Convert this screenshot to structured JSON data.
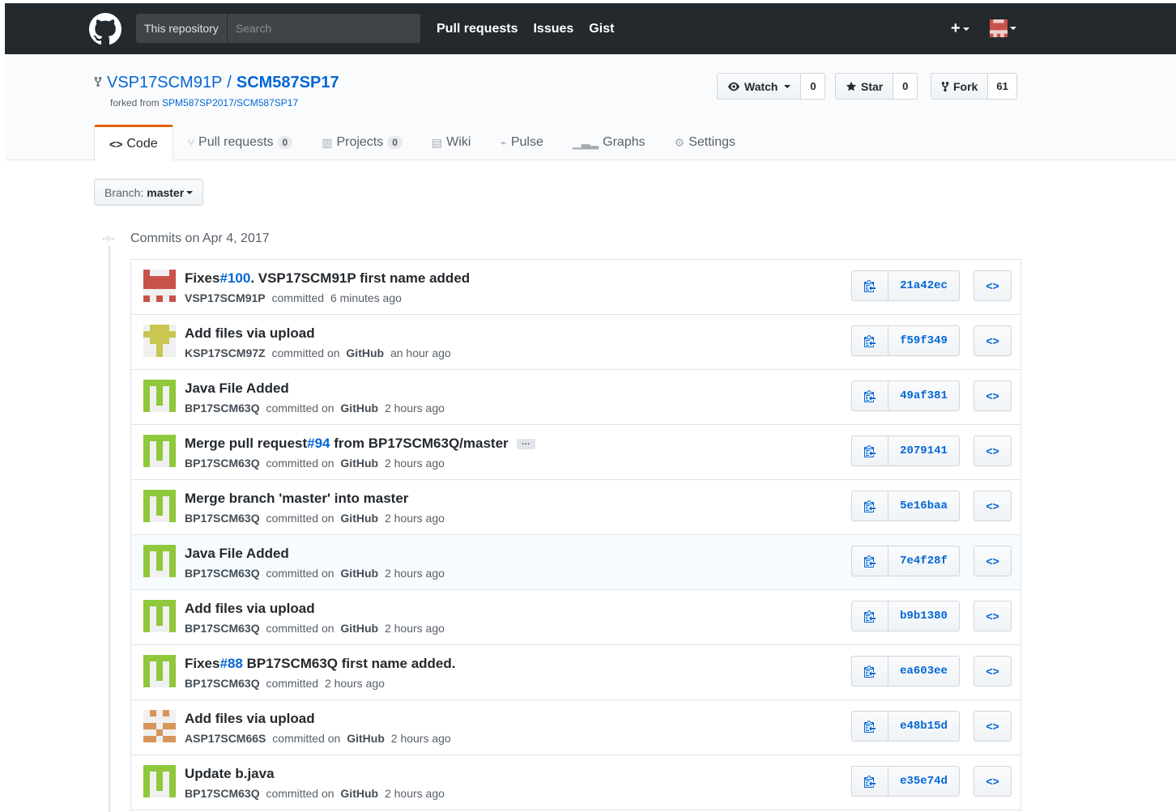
{
  "header": {
    "search_scope": "This repository",
    "search_placeholder": "Search",
    "nav": [
      "Pull requests",
      "Issues",
      "Gist"
    ],
    "plus_label": "+"
  },
  "repo": {
    "owner": "VSP17SCM91P",
    "separator": "/",
    "name": "SCM587SP17",
    "forked_prefix": "forked from",
    "forked_from": "SPM587SP2017/SCM587SP17",
    "watch_label": "Watch",
    "watch_count": "0",
    "star_label": "Star",
    "star_count": "0",
    "fork_label": "Fork",
    "fork_count": "61"
  },
  "tabs": [
    {
      "label": "Code",
      "icon": "code-icon",
      "counter": ""
    },
    {
      "label": "Pull requests",
      "icon": "pull-request-icon",
      "counter": "0"
    },
    {
      "label": "Projects",
      "icon": "project-icon",
      "counter": "0"
    },
    {
      "label": "Wiki",
      "icon": "book-icon",
      "counter": ""
    },
    {
      "label": "Pulse",
      "icon": "pulse-icon",
      "counter": ""
    },
    {
      "label": "Graphs",
      "icon": "graph-icon",
      "counter": ""
    },
    {
      "label": "Settings",
      "icon": "gear-icon",
      "counter": ""
    }
  ],
  "branch": {
    "prefix": "Branch:",
    "name": "master"
  },
  "commits_day": "Commits on Apr 4, 2017",
  "commits": [
    {
      "pre": "Fixes ",
      "link": "#100",
      "post": ". VSP17SCM91P first name added",
      "author": "VSP17SCM91P",
      "verb": "committed",
      "on": "",
      "time": "6 minutes ago",
      "sha": "21a42ec",
      "avatar_color": "#c8524a",
      "ellipsis": false
    },
    {
      "pre": "Add files via upload",
      "link": "",
      "post": "",
      "author": "KSP17SCM97Z",
      "verb": "committed on",
      "on": "GitHub",
      "time": "an hour ago",
      "sha": "f59f349",
      "avatar_color": "#c9c651",
      "ellipsis": false
    },
    {
      "pre": "Java File Added",
      "link": "",
      "post": "",
      "author": "BP17SCM63Q",
      "verb": "committed on",
      "on": "GitHub",
      "time": "2 hours ago",
      "sha": "49af381",
      "avatar_color": "#8fc83b",
      "ellipsis": false
    },
    {
      "pre": "Merge pull request ",
      "link": "#94",
      "post": " from BP17SCM63Q/master",
      "author": "BP17SCM63Q",
      "verb": "committed on",
      "on": "GitHub",
      "time": "2 hours ago",
      "sha": "2079141",
      "avatar_color": "#8fc83b",
      "ellipsis": true,
      "ellipsis_text": "…"
    },
    {
      "pre": "Merge branch 'master' into master",
      "link": "",
      "post": "",
      "author": "BP17SCM63Q",
      "verb": "committed on",
      "on": "GitHub",
      "time": "2 hours ago",
      "sha": "5e16baa",
      "avatar_color": "#8fc83b",
      "ellipsis": false
    },
    {
      "pre": "Java File Added",
      "link": "",
      "post": "",
      "author": "BP17SCM63Q",
      "verb": "committed on",
      "on": "GitHub",
      "time": "2 hours ago",
      "sha": "7e4f28f",
      "avatar_color": "#8fc83b",
      "ellipsis": false,
      "highlight": true
    },
    {
      "pre": "Add files via upload",
      "link": "",
      "post": "",
      "author": "BP17SCM63Q",
      "verb": "committed on",
      "on": "GitHub",
      "time": "2 hours ago",
      "sha": "b9b1380",
      "avatar_color": "#8fc83b",
      "ellipsis": false
    },
    {
      "pre": "Fixes ",
      "link": "#88",
      "post": " BP17SCM63Q first name added.",
      "author": "BP17SCM63Q",
      "verb": "committed",
      "on": "",
      "time": "2 hours ago",
      "sha": "ea603ee",
      "avatar_color": "#8fc83b",
      "ellipsis": false
    },
    {
      "pre": "Add files via upload",
      "link": "",
      "post": "",
      "author": "ASP17SCM66S",
      "verb": "committed on",
      "on": "GitHub",
      "time": "2 hours ago",
      "sha": "e48b15d",
      "avatar_color": "#d7955a",
      "ellipsis": false
    },
    {
      "pre": "Update b.java",
      "link": "",
      "post": "",
      "author": "BP17SCM63Q",
      "verb": "committed on",
      "on": "GitHub",
      "time": "2 hours ago",
      "sha": "e35e74d",
      "avatar_color": "#8fc83b",
      "ellipsis": false
    }
  ],
  "browse_label": "<>"
}
